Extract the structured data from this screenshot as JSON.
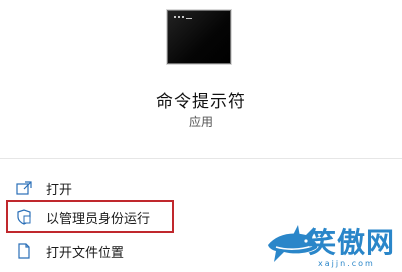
{
  "app": {
    "title": "命令提示符",
    "type": "应用",
    "icon": "command-prompt-icon"
  },
  "menu": {
    "items": [
      {
        "label": "打开",
        "icon": "open-window-icon"
      },
      {
        "label": "以管理员身份运行",
        "icon": "shield-icon",
        "highlighted": true
      },
      {
        "label": "打开文件位置",
        "icon": "file-location-icon"
      }
    ]
  },
  "watermark": {
    "text": "笑傲网",
    "url": "xajjn.com"
  },
  "colors": {
    "highlight_border": "#c0282d",
    "icon_blue": "#2a6fb8",
    "watermark_blue": "#2a86c9"
  }
}
